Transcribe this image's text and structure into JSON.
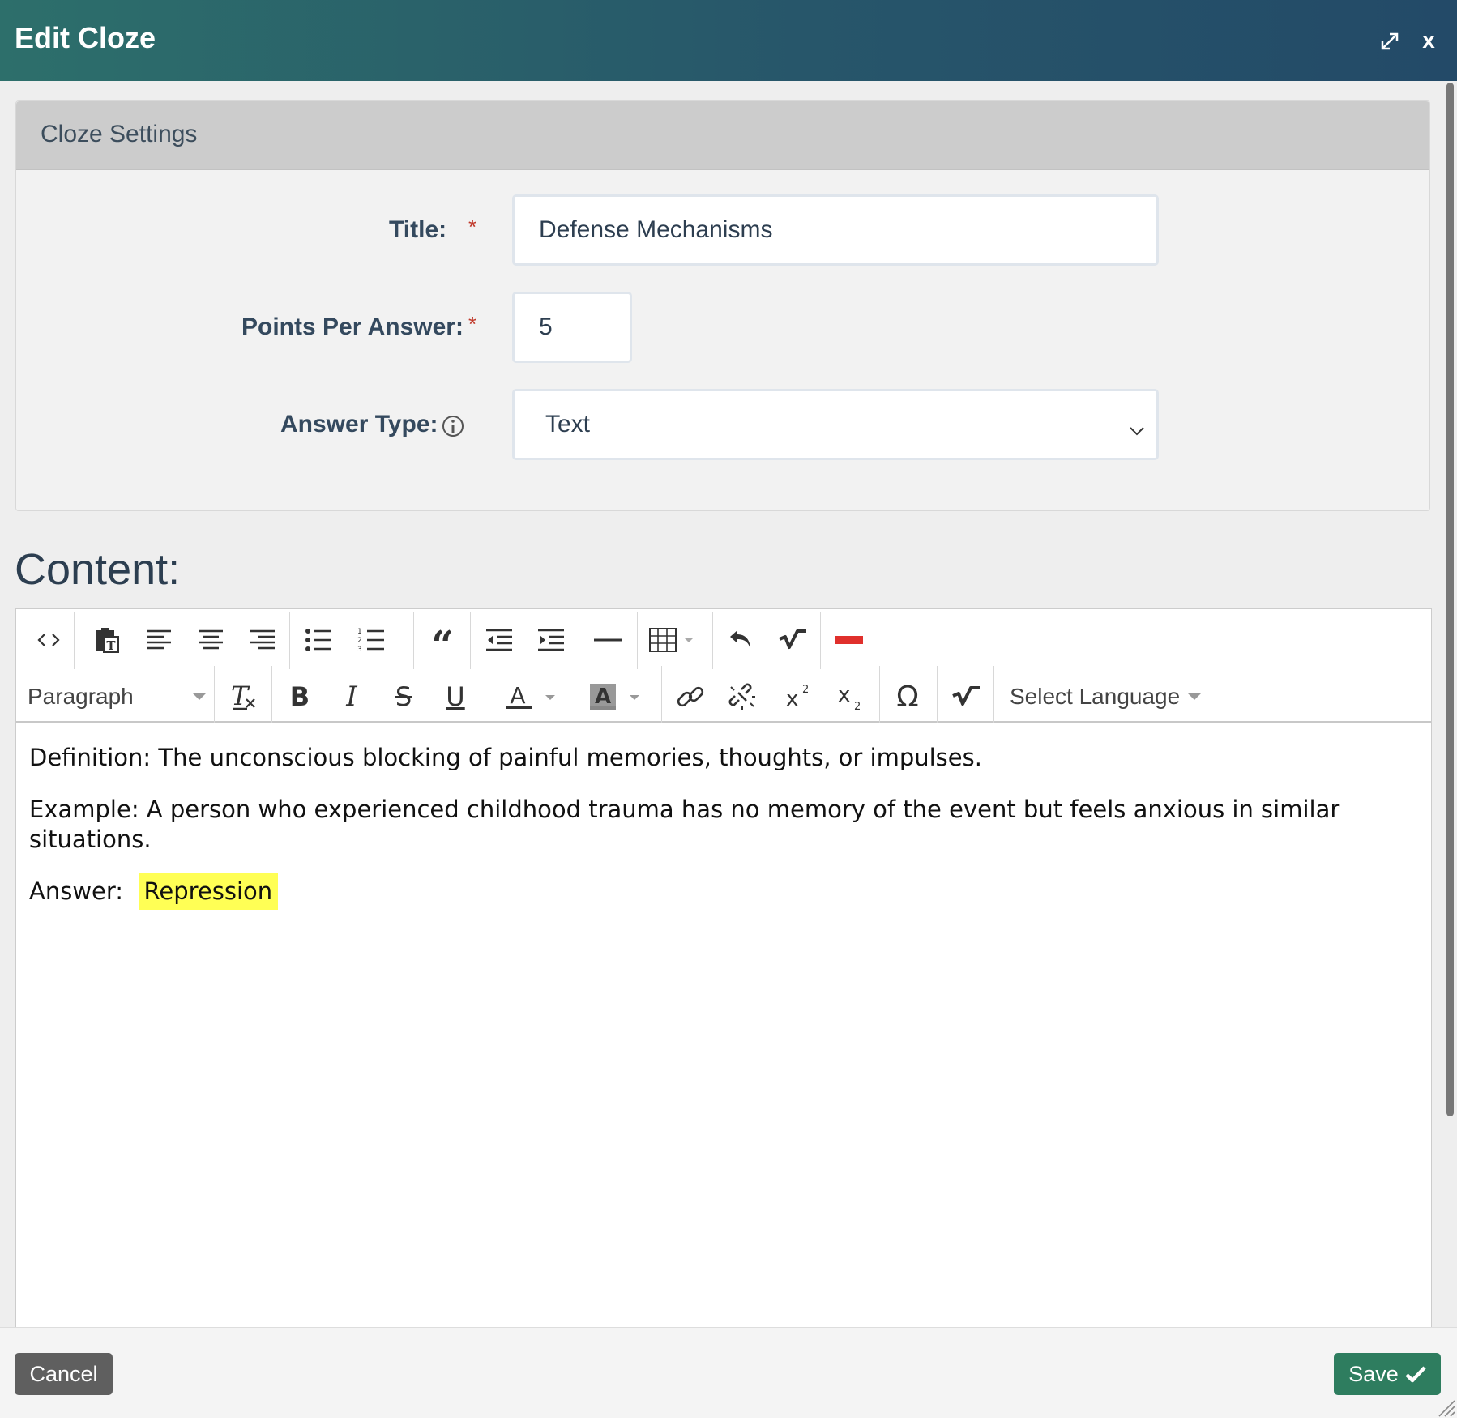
{
  "window": {
    "title": "Edit Cloze",
    "close_label": "x"
  },
  "settings": {
    "heading": "Cloze Settings",
    "title_label": "Title:",
    "title_value": "Defense Mechanisms",
    "points_label": "Points Per Answer:",
    "points_value": "5",
    "answer_type_label": "Answer Type:",
    "answer_type_value": "Text",
    "required_mark": "*"
  },
  "content": {
    "heading": "Content:",
    "toolbar": {
      "row1_icons": [
        "code-icon",
        "paste-text-icon",
        "align-left-icon",
        "align-center-icon",
        "align-right-icon",
        "bullet-list-icon",
        "numbered-list-icon",
        "blockquote-icon",
        "outdent-icon",
        "indent-icon",
        "horizontal-rule-icon",
        "table-icon",
        "undo-icon",
        "math-icon",
        "remove-icon"
      ],
      "format_select": "Paragraph",
      "language_select": "Select Language",
      "row2_icons": [
        "clear-format-icon",
        "bold-icon",
        "italic-icon",
        "strikethrough-icon",
        "underline-icon",
        "text-color-icon",
        "background-color-icon",
        "link-icon",
        "unlink-icon",
        "superscript-icon",
        "subscript-icon",
        "special-char-icon",
        "math-icon"
      ]
    },
    "paragraphs": {
      "definition": "Definition: The unconscious blocking of painful memories, thoughts, or impulses.",
      "example": "Example: A person who experienced childhood trauma has no memory of the event but feels anxious in similar situations.",
      "answer_prefix": "Answer:",
      "answer_value": "Repression"
    }
  },
  "footer": {
    "cancel_label": "Cancel",
    "save_label": "Save"
  },
  "colors": {
    "header_start": "#2d6f6b",
    "header_end": "#234a68",
    "save": "#2e7d5f",
    "highlight": "#ffff55",
    "required": "#c0392b"
  }
}
